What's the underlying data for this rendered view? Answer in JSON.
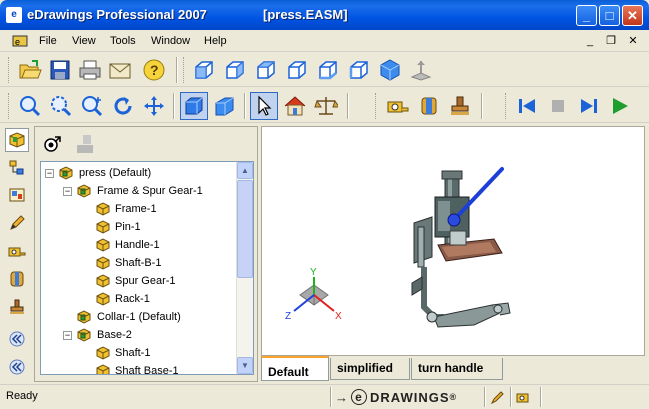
{
  "window": {
    "app_title": "eDrawings Professional 2007",
    "document_title": "[press.EASM]",
    "app_icon_text": "e",
    "min_symbol": "_",
    "max_symbol": "□",
    "close_symbol": "✕"
  },
  "menu": {
    "items": [
      "File",
      "View",
      "Tools",
      "Window",
      "Help"
    ],
    "mdi_min": "_",
    "mdi_restore": "❐",
    "mdi_close": "✕"
  },
  "toolbar_main": {
    "icons": [
      "open-icon",
      "save-icon",
      "print-icon",
      "email-icon",
      "help-icon",
      "view-front-icon",
      "view-back-icon",
      "view-left-icon",
      "view-right-icon",
      "view-top-icon",
      "view-bottom-icon",
      "view-iso-icon",
      "view-normal-icon"
    ]
  },
  "toolbar_view": {
    "icons": [
      "zoom-fit-icon",
      "zoom-area-icon",
      "zoom-icon",
      "rotate-icon",
      "pan-icon",
      "shaded-icon",
      "perspective-icon",
      "select-icon",
      "home-icon",
      "mass-props-icon",
      "measure-icon",
      "section-icon",
      "stamp-icon",
      "first-icon",
      "stop-icon",
      "next-icon",
      "play-icon"
    ]
  },
  "left_tabs": [
    "components-tab",
    "configurations-tab",
    "sheets-tab",
    "markup-tab",
    "measure-tab",
    "section-tab",
    "stamp-tab",
    "expand-tab",
    "collapse-tab"
  ],
  "tree": {
    "root": "press (Default)",
    "items": [
      {
        "label": "press (Default)",
        "level": 0,
        "expander": "−"
      },
      {
        "label": "Frame & Spur Gear-1",
        "level": 1,
        "expander": "−"
      },
      {
        "label": "Frame-1",
        "level": 2,
        "expander": ""
      },
      {
        "label": "Pin-1",
        "level": 2,
        "expander": ""
      },
      {
        "label": "Handle-1",
        "level": 2,
        "expander": ""
      },
      {
        "label": "Shaft-B-1",
        "level": 2,
        "expander": ""
      },
      {
        "label": "Spur Gear-1",
        "level": 2,
        "expander": ""
      },
      {
        "label": "Rack-1",
        "level": 2,
        "expander": ""
      },
      {
        "label": "Collar-1 (Default)",
        "level": 1,
        "expander": ""
      },
      {
        "label": "Base-2",
        "level": 1,
        "expander": "−"
      },
      {
        "label": "Shaft-1",
        "level": 2,
        "expander": ""
      },
      {
        "label": "Shaft Base-1",
        "level": 2,
        "expander": ""
      }
    ],
    "scroll_up": "▲",
    "scroll_down": "▼"
  },
  "viewport": {
    "axis_labels": {
      "x": "X",
      "y": "Y",
      "z": "Z"
    }
  },
  "config_tabs": [
    "Default",
    "simplified",
    "turn handle"
  ],
  "status": {
    "text": "Ready",
    "logo_text": "DRAWINGS",
    "logo_mark": "®",
    "logo_prefix": "e"
  },
  "colors": {
    "titlebar": "#0054E3",
    "chrome": "#ECE9D8",
    "handle_blue": "#1C3FD8",
    "axis_x": "#E02020",
    "axis_y": "#20B020",
    "axis_z": "#2040E0",
    "play_green": "#1E9E2E"
  }
}
